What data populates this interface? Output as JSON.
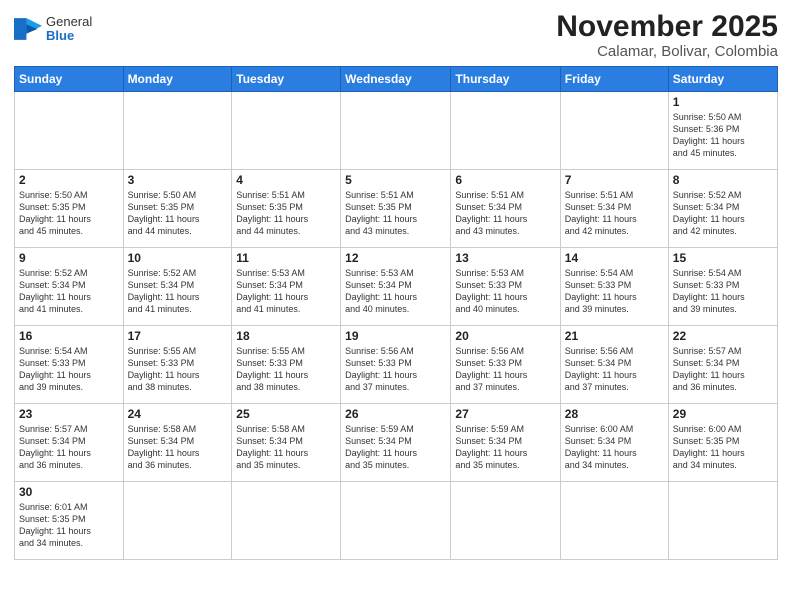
{
  "header": {
    "logo_general": "General",
    "logo_blue": "Blue",
    "month_title": "November 2025",
    "location": "Calamar, Bolivar, Colombia"
  },
  "days_of_week": [
    "Sunday",
    "Monday",
    "Tuesday",
    "Wednesday",
    "Thursday",
    "Friday",
    "Saturday"
  ],
  "weeks": [
    [
      {
        "day": "",
        "info": ""
      },
      {
        "day": "",
        "info": ""
      },
      {
        "day": "",
        "info": ""
      },
      {
        "day": "",
        "info": ""
      },
      {
        "day": "",
        "info": ""
      },
      {
        "day": "",
        "info": ""
      },
      {
        "day": "1",
        "info": "Sunrise: 5:50 AM\nSunset: 5:36 PM\nDaylight: 11 hours\nand 45 minutes."
      }
    ],
    [
      {
        "day": "2",
        "info": "Sunrise: 5:50 AM\nSunset: 5:35 PM\nDaylight: 11 hours\nand 45 minutes."
      },
      {
        "day": "3",
        "info": "Sunrise: 5:50 AM\nSunset: 5:35 PM\nDaylight: 11 hours\nand 44 minutes."
      },
      {
        "day": "4",
        "info": "Sunrise: 5:51 AM\nSunset: 5:35 PM\nDaylight: 11 hours\nand 44 minutes."
      },
      {
        "day": "5",
        "info": "Sunrise: 5:51 AM\nSunset: 5:35 PM\nDaylight: 11 hours\nand 43 minutes."
      },
      {
        "day": "6",
        "info": "Sunrise: 5:51 AM\nSunset: 5:34 PM\nDaylight: 11 hours\nand 43 minutes."
      },
      {
        "day": "7",
        "info": "Sunrise: 5:51 AM\nSunset: 5:34 PM\nDaylight: 11 hours\nand 42 minutes."
      },
      {
        "day": "8",
        "info": "Sunrise: 5:52 AM\nSunset: 5:34 PM\nDaylight: 11 hours\nand 42 minutes."
      }
    ],
    [
      {
        "day": "9",
        "info": "Sunrise: 5:52 AM\nSunset: 5:34 PM\nDaylight: 11 hours\nand 41 minutes."
      },
      {
        "day": "10",
        "info": "Sunrise: 5:52 AM\nSunset: 5:34 PM\nDaylight: 11 hours\nand 41 minutes."
      },
      {
        "day": "11",
        "info": "Sunrise: 5:53 AM\nSunset: 5:34 PM\nDaylight: 11 hours\nand 41 minutes."
      },
      {
        "day": "12",
        "info": "Sunrise: 5:53 AM\nSunset: 5:34 PM\nDaylight: 11 hours\nand 40 minutes."
      },
      {
        "day": "13",
        "info": "Sunrise: 5:53 AM\nSunset: 5:33 PM\nDaylight: 11 hours\nand 40 minutes."
      },
      {
        "day": "14",
        "info": "Sunrise: 5:54 AM\nSunset: 5:33 PM\nDaylight: 11 hours\nand 39 minutes."
      },
      {
        "day": "15",
        "info": "Sunrise: 5:54 AM\nSunset: 5:33 PM\nDaylight: 11 hours\nand 39 minutes."
      }
    ],
    [
      {
        "day": "16",
        "info": "Sunrise: 5:54 AM\nSunset: 5:33 PM\nDaylight: 11 hours\nand 39 minutes."
      },
      {
        "day": "17",
        "info": "Sunrise: 5:55 AM\nSunset: 5:33 PM\nDaylight: 11 hours\nand 38 minutes."
      },
      {
        "day": "18",
        "info": "Sunrise: 5:55 AM\nSunset: 5:33 PM\nDaylight: 11 hours\nand 38 minutes."
      },
      {
        "day": "19",
        "info": "Sunrise: 5:56 AM\nSunset: 5:33 PM\nDaylight: 11 hours\nand 37 minutes."
      },
      {
        "day": "20",
        "info": "Sunrise: 5:56 AM\nSunset: 5:33 PM\nDaylight: 11 hours\nand 37 minutes."
      },
      {
        "day": "21",
        "info": "Sunrise: 5:56 AM\nSunset: 5:34 PM\nDaylight: 11 hours\nand 37 minutes."
      },
      {
        "day": "22",
        "info": "Sunrise: 5:57 AM\nSunset: 5:34 PM\nDaylight: 11 hours\nand 36 minutes."
      }
    ],
    [
      {
        "day": "23",
        "info": "Sunrise: 5:57 AM\nSunset: 5:34 PM\nDaylight: 11 hours\nand 36 minutes."
      },
      {
        "day": "24",
        "info": "Sunrise: 5:58 AM\nSunset: 5:34 PM\nDaylight: 11 hours\nand 36 minutes."
      },
      {
        "day": "25",
        "info": "Sunrise: 5:58 AM\nSunset: 5:34 PM\nDaylight: 11 hours\nand 35 minutes."
      },
      {
        "day": "26",
        "info": "Sunrise: 5:59 AM\nSunset: 5:34 PM\nDaylight: 11 hours\nand 35 minutes."
      },
      {
        "day": "27",
        "info": "Sunrise: 5:59 AM\nSunset: 5:34 PM\nDaylight: 11 hours\nand 35 minutes."
      },
      {
        "day": "28",
        "info": "Sunrise: 6:00 AM\nSunset: 5:34 PM\nDaylight: 11 hours\nand 34 minutes."
      },
      {
        "day": "29",
        "info": "Sunrise: 6:00 AM\nSunset: 5:35 PM\nDaylight: 11 hours\nand 34 minutes."
      }
    ],
    [
      {
        "day": "30",
        "info": "Sunrise: 6:01 AM\nSunset: 5:35 PM\nDaylight: 11 hours\nand 34 minutes."
      },
      {
        "day": "",
        "info": ""
      },
      {
        "day": "",
        "info": ""
      },
      {
        "day": "",
        "info": ""
      },
      {
        "day": "",
        "info": ""
      },
      {
        "day": "",
        "info": ""
      },
      {
        "day": "",
        "info": ""
      }
    ]
  ]
}
